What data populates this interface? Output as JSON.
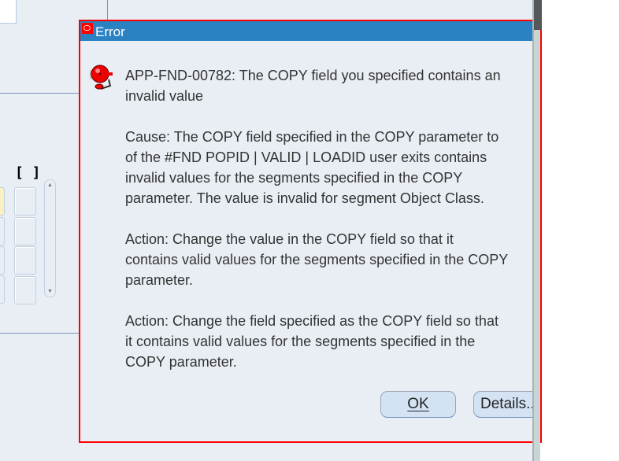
{
  "background": {
    "bracket_label": "[ ]"
  },
  "dialog": {
    "title": "Error",
    "icon": "alarm-bell-icon",
    "message_lines": [
      "APP-FND-00782: The COPY field you specified contains an",
      "invalid value",
      "",
      "Cause: The COPY field specified in the COPY parameter to",
      "of the #FND POPID | VALID | LOADID user exits contains",
      "invalid values for the segments specified in the COPY",
      "parameter. The value  is invalid for segment Object Class.",
      "",
      "Action: Change the value in the COPY field so that it",
      "contains valid values for the segments specified in the COPY",
      "parameter.",
      "",
      "Action: Change the field specified as the COPY field so that",
      "it contains valid values for the segments specified in the",
      "COPY parameter."
    ],
    "ok_label": "OK",
    "details_label": "Details..."
  },
  "colors": {
    "title_bar": "#2b82c3",
    "border": "#ff0000"
  }
}
